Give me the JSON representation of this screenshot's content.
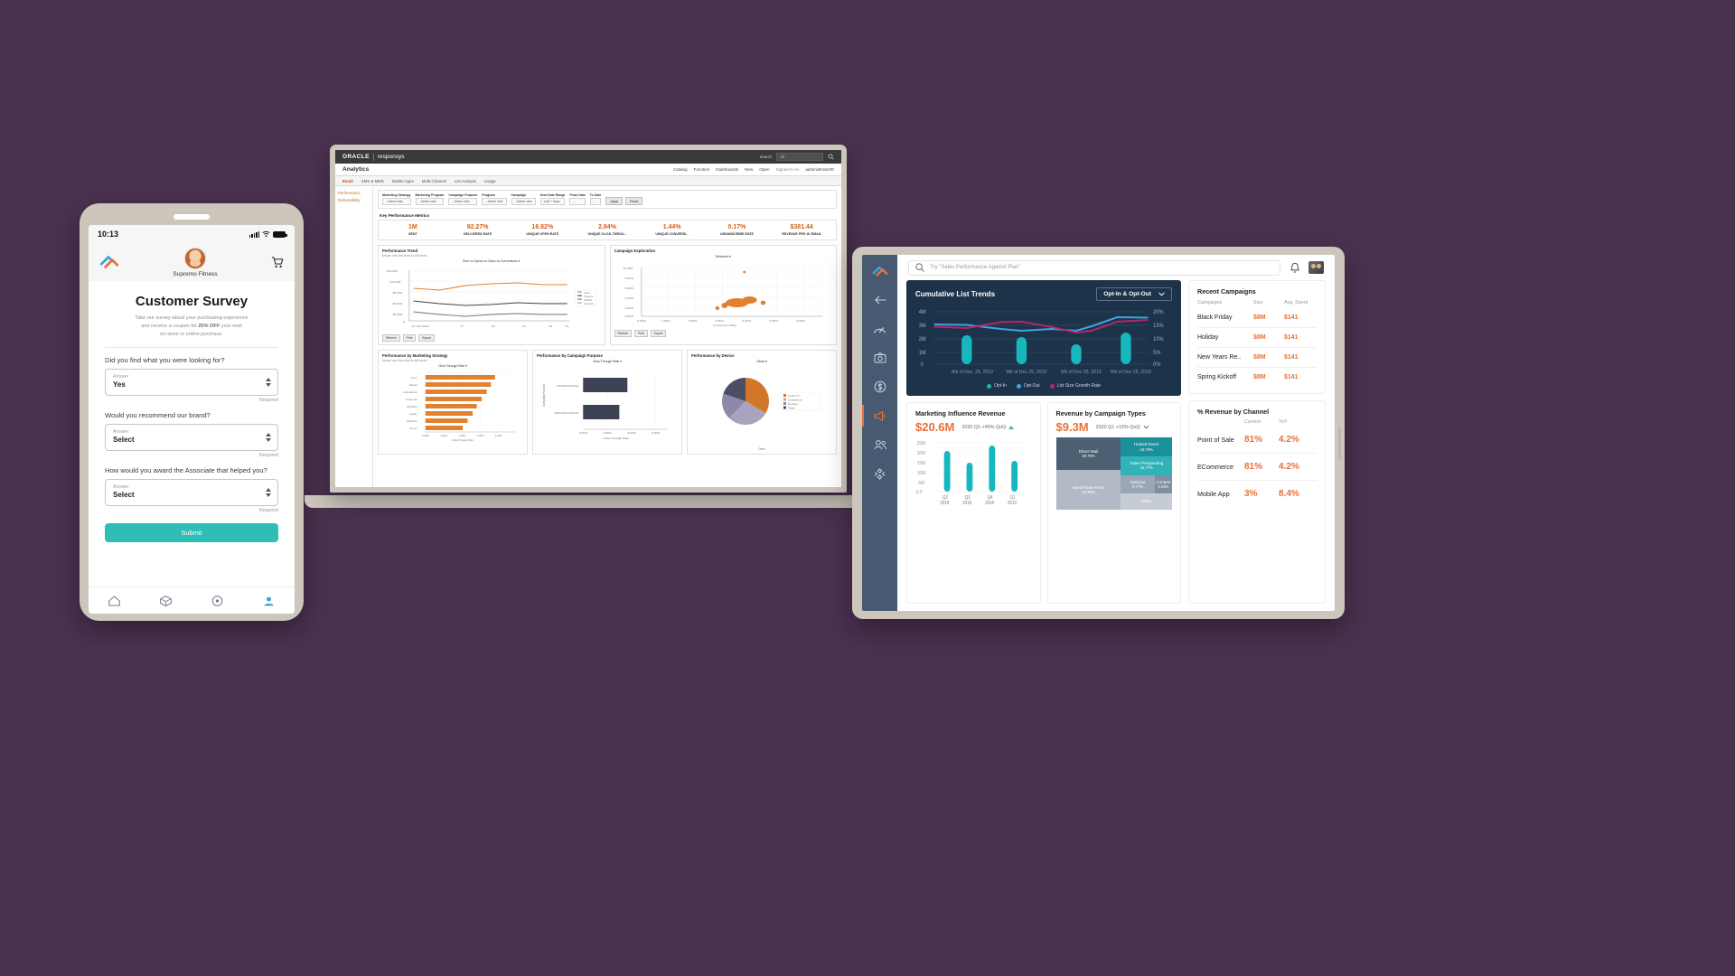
{
  "theme": {
    "background": "#4a3150",
    "accent_orange": "#e8703a",
    "accent_teal": "#2fbdb8",
    "dark_navy": "#1d3349",
    "rail": "#475a71"
  },
  "phone": {
    "status": {
      "time": "10:13"
    },
    "app_header": {
      "brand_name": "Supremo Fitness"
    },
    "survey": {
      "title": "Customer Survey",
      "subtitle_1": "Take our survey  about your purchasing experience",
      "subtitle_2a": "and receive a coupon for ",
      "subtitle_2b": "25% OFF",
      "subtitle_2c": " your next",
      "subtitle_3": "on-store or online purchase.",
      "questions": [
        {
          "label": "Did you find what you were looking for?",
          "field_label": "Answer",
          "value": "Yes",
          "required": "Required"
        },
        {
          "label": "Would you recommend our brand?",
          "field_label": "Answer",
          "value": "Select",
          "required": "Required"
        },
        {
          "label": "How would you award the Associate that helped you?",
          "field_label": "Answer",
          "value": "Select",
          "required": "Required"
        }
      ],
      "submit_label": "Submit"
    },
    "tabbar": [
      {
        "icon": "home-icon"
      },
      {
        "icon": "box-icon"
      },
      {
        "icon": "location-icon"
      },
      {
        "icon": "profile-icon"
      }
    ]
  },
  "laptop": {
    "topbar": {
      "brand": "ORACLE",
      "product": "responsys",
      "search_label": "Search",
      "search_scope": "All"
    },
    "navbar": {
      "title": "Analytics",
      "menu": [
        "Catalog",
        "Function",
        "Dashboards",
        "New",
        "Open"
      ],
      "signed_in": "Signed In As",
      "user": "administrator00"
    },
    "tabs": [
      {
        "label": "Email",
        "active": true
      },
      {
        "label": "SMS & MMS",
        "active": false
      },
      {
        "label": "Mobile Apps",
        "active": false
      },
      {
        "label": "Multi-Channel",
        "active": false
      },
      {
        "label": "List Analysis",
        "active": false
      },
      {
        "label": "Usage",
        "active": false
      }
    ],
    "sidebar": [
      "Performance",
      "Deliverability"
    ],
    "filters": [
      {
        "label": "Marketing Strategy",
        "value": "--Select Valu"
      },
      {
        "label": "Marketing Program",
        "value": "--Select Valu"
      },
      {
        "label": "Campaign Purpose",
        "value": "--Select Valu"
      },
      {
        "label": "Program",
        "value": "--Select Valu"
      },
      {
        "label": "Campaign",
        "value": "--Select Valu"
      },
      {
        "label": "Sent Date Range",
        "value": "Last 7 Days"
      },
      {
        "label": "From Date",
        "value": "--"
      },
      {
        "label": "To Date",
        "value": "--"
      }
    ],
    "filter_actions": [
      "Apply",
      "Reset"
    ],
    "kpi_header": "Key Performance Metrics",
    "kpis": [
      {
        "value": "1M",
        "label": "SENT"
      },
      {
        "value": "92.27%",
        "label": "DELIVERED RATE"
      },
      {
        "value": "16.82%",
        "label": "UNIQUE OPEN RATE"
      },
      {
        "value": "2.84%",
        "label": "UNIQUE CLICK-THROU..."
      },
      {
        "value": "1.44%",
        "label": "UNIQUE CONVERSI..."
      },
      {
        "value": "0.17%",
        "label": "UNSUBSCRIBE RATE"
      },
      {
        "value": "$381.44",
        "label": "REVENUE PER 1K EMAIL"
      }
    ],
    "panels": {
      "performance_trend": {
        "title": "Performance Trend",
        "subtitle": "Mouse over the chart to drill down",
        "dropdown": "Sent vs Opens vs Clicks vs Conversions",
        "xlabel": "Sent Date",
        "ylabel": "Sent, Open, Click, Conversion",
        "actions": [
          "Refresh",
          "Print",
          "Export"
        ]
      },
      "campaign_exploration": {
        "title": "Campaign Exploration",
        "dropdown": "Delivered",
        "xlabel": "Conversion Rate",
        "ylabel": "Click Through Rate",
        "actions": [
          "Refresh",
          "Print",
          "Export"
        ]
      },
      "by_strategy": {
        "title": "Performance by Marketing Strategy",
        "subtitle": "Mouse over the chart to drill down",
        "dropdown": "Click-Through Rate",
        "xlabel": "Click-Through Rate"
      },
      "by_purpose": {
        "title": "Performance by Campaign Purpose",
        "dropdown": "Click-Through Rate",
        "xlabel": "Click-Through Rate",
        "ylabel": "Campaign Purpose"
      },
      "by_device": {
        "title": "Performance by Device",
        "dropdown": "Clicks",
        "footer": "Other"
      }
    },
    "chart_data": [
      {
        "type": "line",
        "title": "Performance Trend",
        "xlabel": "Sent Date",
        "ylabel": "Sent, Open, Click, Conversion",
        "x": [
          "14 July 2020",
          "17",
          "20",
          "24",
          "28",
          "31"
        ],
        "legend": [
          "Sent",
          "Opens",
          "Clicks",
          "Conversions"
        ],
        "ylim": [
          0,
          150000
        ],
        "yticks": [
          "150,000",
          "120,000",
          "90,000",
          "60,000",
          "30,000",
          "0"
        ],
        "series": [
          {
            "name": "Sent",
            "values": [
              95000,
              92000,
              98000,
              101000,
              103000,
              99000
            ]
          },
          {
            "name": "Opens",
            "values": [
              62000,
              58000,
              55000,
              57000,
              60000,
              58000
            ]
          },
          {
            "name": "Clicks",
            "values": [
              34000,
              30000,
              28000,
              31000,
              33000,
              32000
            ]
          }
        ]
      },
      {
        "type": "scatter",
        "title": "Campaign Exploration",
        "xlabel": "Conversion Rate",
        "ylabel": "Click Through Rate",
        "xticks": [
          "0.00%",
          "1.00%",
          "2.00%",
          "3.00%",
          "4.00%",
          "5.00%",
          "6.00%",
          "7.00%",
          "8.00%"
        ],
        "yticks": [
          "10.00%",
          "8.00%",
          "6.00%",
          "4.00%",
          "2.00%",
          "0.00%"
        ],
        "points": [
          {
            "x": 4.4,
            "y": 9.0
          },
          {
            "x": 3.0,
            "y": 3.6
          },
          {
            "x": 3.6,
            "y": 2.9
          },
          {
            "x": 4.4,
            "y": 3.4
          },
          {
            "x": 5.2,
            "y": 3.0
          },
          {
            "x": 2.2,
            "y": 2.4
          }
        ]
      },
      {
        "type": "bar",
        "title": "Performance by Marketing Strategy",
        "orientation": "horizontal",
        "xlabel": "Click-Through Rate",
        "categories": [
          "Top 1",
          "Reload",
          "International",
          "Cross Sell",
          "Win Back",
          "Loyalty",
          "Welcome",
          "Promo"
        ],
        "values": [
          4.6,
          4.3,
          4.0,
          3.7,
          3.4,
          3.1,
          2.8,
          2.4
        ],
        "xticks": [
          "0.00%",
          "1.00%",
          "2.00%",
          "3.00%",
          "4.00%",
          "5.00%"
        ]
      },
      {
        "type": "bar",
        "title": "Performance by Campaign Purpose",
        "orientation": "horizontal",
        "xlabel": "Click-Through Rate",
        "ylabel": "Campaign Purpose",
        "categories": [
          "PROMOTIONAL",
          "TRANSACTIONAL"
        ],
        "values": [
          5.2,
          3.6
        ],
        "xticks": [
          "0.00%",
          "2.00%",
          "4.00%",
          "6.00%"
        ]
      },
      {
        "type": "pie",
        "title": "Performance by Device",
        "labels": [
          "Smart TV",
          "Smartphone",
          "Desktop",
          "Tablet"
        ],
        "values": [
          42,
          33,
          17,
          8
        ]
      }
    ]
  },
  "tablet": {
    "rail": [
      {
        "icon": "brand-logo-icon",
        "selected": false
      },
      {
        "icon": "back-arrow-icon",
        "selected": false
      },
      {
        "icon": "speedometer-icon",
        "selected": false
      },
      {
        "icon": "camera-icon",
        "selected": false
      },
      {
        "icon": "dollar-circle-icon",
        "selected": false
      },
      {
        "icon": "megaphone-icon",
        "selected": true
      },
      {
        "icon": "people-icon",
        "selected": false
      },
      {
        "icon": "apps-icon",
        "selected": false
      }
    ],
    "search": {
      "placeholder": "Try \"Sales Performance Against Plan\"",
      "icon": "search-icon"
    },
    "top_icons": [
      {
        "icon": "bell-icon"
      },
      {
        "icon": "avatar"
      }
    ],
    "cumulative": {
      "title": "Cumulative List Trends",
      "dropdown": "Opt-In & Opt-Out",
      "legend": [
        "Opt-In",
        "Opt-Out",
        "List Size Growth Rate"
      ]
    },
    "marketing_influence": {
      "title": "Marketing Influence Revenue",
      "value": "$20.6M",
      "delta": "2020 Q1 +45% QoQ"
    },
    "revenue_types": {
      "title": "Revenue by Campaign Types",
      "value": "$9.3M",
      "delta": "2020 Q1 +15% QoQ"
    },
    "recent_campaigns": {
      "title": "Recent Campaigns",
      "columns": [
        "Campaigns",
        "Size",
        "Avg. Spent"
      ],
      "rows": [
        {
          "name": "Black Friday",
          "size": "$8M",
          "spent": "$141"
        },
        {
          "name": "Holiday",
          "size": "$8M",
          "spent": "$141"
        },
        {
          "name": "New Years Re..",
          "size": "$8M",
          "spent": "$141"
        },
        {
          "name": "Spring Kickoff",
          "size": "$8M",
          "spent": "$141"
        }
      ]
    },
    "revenue_channel": {
      "title": "% Revenue by Channel",
      "columns": [
        "Current",
        "YoY"
      ],
      "rows": [
        {
          "name": "Point of Sale",
          "current": "81%",
          "yoy": "4.2%"
        },
        {
          "name": "ECommerce",
          "current": "81%",
          "yoy": "4.2%"
        },
        {
          "name": "Mobile App",
          "current": "3%",
          "yoy": "8.4%"
        }
      ]
    },
    "chart_data": [
      {
        "type": "line",
        "title": "Cumulative List Trends",
        "yticks": [
          "4M",
          "3M",
          "2M",
          "1M",
          "0"
        ],
        "ylim": [
          0,
          4000000
        ],
        "y2ticks": [
          "20%",
          "15%",
          "10%",
          "5%",
          "0%"
        ],
        "categories": [
          "Wk of Dec. 25, 2019",
          "Wk of Dec 25, 2019",
          "Wk of Dec 25, 2019",
          "Wk of Dec 25, 2019"
        ],
        "legend": [
          "Opt-In",
          "Opt-Out",
          "List Size Growth Rate"
        ],
        "series": [
          {
            "name": "Opt-In",
            "type": "bar",
            "values": [
              2100000,
              2000000,
              1450000,
              2300000
            ]
          },
          {
            "name": "List Size Growth Rate",
            "type": "line",
            "values": [
              3050000,
              3020000,
              2700000,
              3650000,
              3600000
            ]
          },
          {
            "name": "Opt-Out",
            "type": "line",
            "values": [
              2950000,
              3150000,
              3300000,
              2600000,
              3450000
            ]
          }
        ]
      },
      {
        "type": "bar",
        "title": "Marketing Influence Revenue",
        "categories": [
          "Q2 2018",
          "Q3 2018",
          "Q4 2018",
          "Q1 2019"
        ],
        "values": [
          20.5,
          15.0,
          23.5,
          16.0
        ],
        "yticks": [
          "25M",
          "20M",
          "15M",
          "10M",
          "5M",
          "0.0"
        ],
        "ylim": [
          0,
          25
        ]
      },
      {
        "type": "treemap",
        "title": "Revenue by Campaign Types",
        "items": [
          {
            "label": "Direct Mail",
            "pct": "29.79%"
          },
          {
            "label": "Hosted Event",
            "pct": "16.79%"
          },
          {
            "label": "Sales Prospecting",
            "pct": "15.77%"
          },
          {
            "label": "Hand Raise Form",
            "pct": "23.39%"
          },
          {
            "label": "Webinar",
            "pct": "9.77%"
          },
          {
            "label": "Content",
            "pct": "4.23%"
          },
          {
            "label": "Other",
            "pct": ""
          }
        ]
      }
    ]
  }
}
